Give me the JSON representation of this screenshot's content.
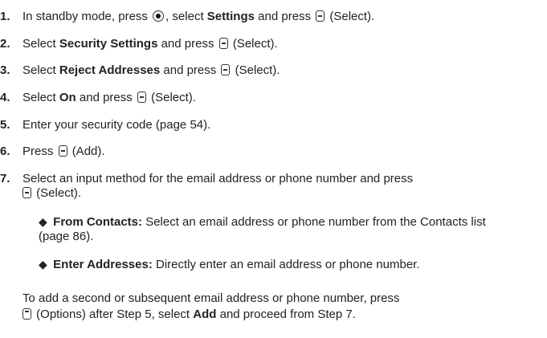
{
  "steps": [
    {
      "num": "1.",
      "t1": "In standby mode, press",
      "t2": ", select",
      "b1": "Settings",
      "t3": "and press",
      "t4": "(Select)."
    },
    {
      "num": "2.",
      "t1": "Select",
      "b1": "Security Settings",
      "t2": "and press",
      "t3": "(Select)."
    },
    {
      "num": "3.",
      "t1": "Select",
      "b1": "Reject Addresses",
      "t2": "and press",
      "t3": "(Select)."
    },
    {
      "num": "4.",
      "t1": "Select",
      "b1": "On",
      "t2": "and press",
      "t3": "(Select)."
    },
    {
      "num": "5.",
      "t1": "Enter your security code (page 54)."
    },
    {
      "num": "6.",
      "t1": "Press",
      "t2": "(Add)."
    },
    {
      "num": "7.",
      "t1": "Select an input method for the email address or phone number and press",
      "t2": "(Select)."
    }
  ],
  "bullets": [
    {
      "label": "From Contacts:",
      "text": "Select an email address or phone number from the Contacts list",
      "text2": "(page 86)."
    },
    {
      "label": "Enter Addresses:",
      "text": "Directly enter an email address or phone number."
    }
  ],
  "note": {
    "line1": "To add a second or subsequent email address or phone number, press",
    "t1": "(Options) after Step 5, select",
    "b1": "Add",
    "t2": "and proceed from Step 7."
  }
}
